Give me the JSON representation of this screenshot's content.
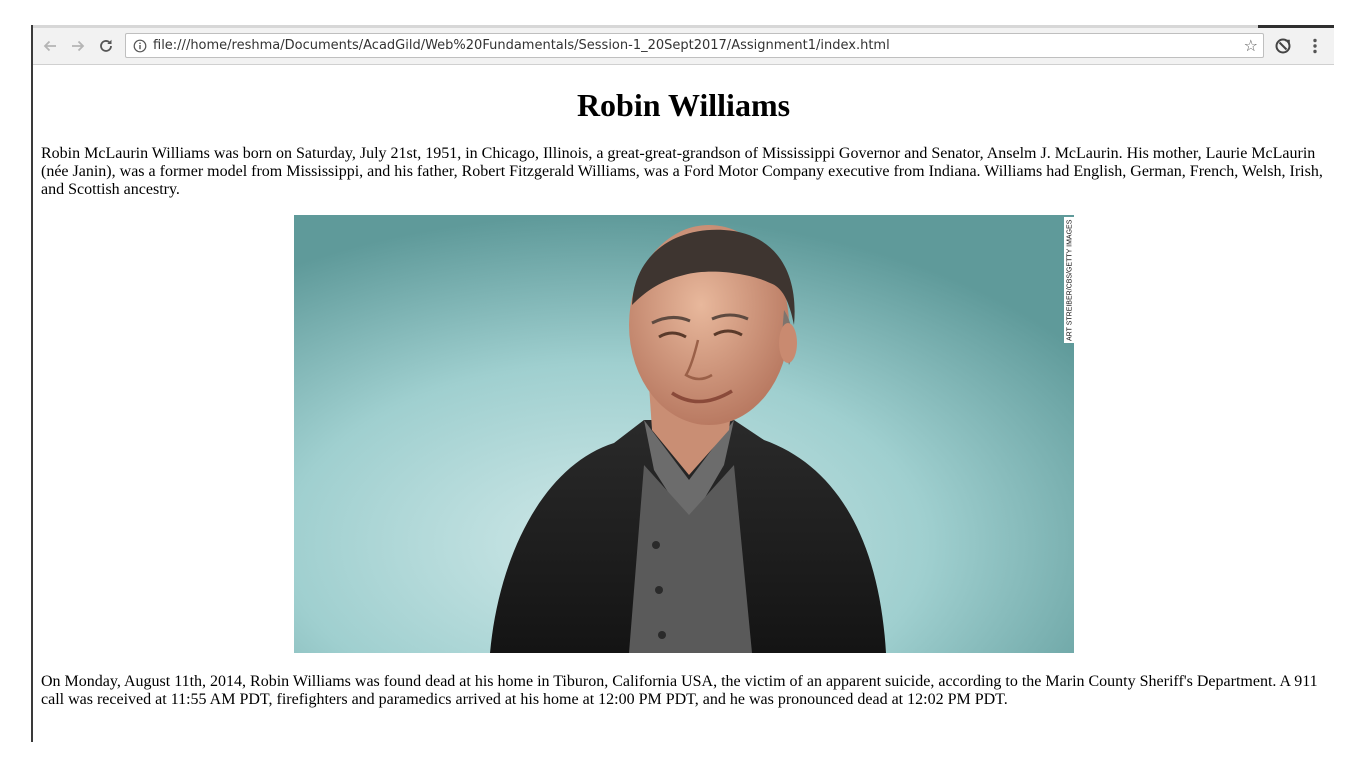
{
  "browser": {
    "url": "file:///home/reshma/Documents/AcadGild/Web%20Fundamentals/Session-1_20Sept2017/Assignment1/index.html",
    "icons": {
      "back": "arrow-left-icon",
      "forward": "arrow-right-icon",
      "reload": "reload-icon",
      "info": "info-icon",
      "bookmark": "star-icon",
      "extension": "extension-icon",
      "menu": "kebab-menu-icon"
    }
  },
  "page": {
    "title": "Robin Williams",
    "paragraph1": "Robin McLaurin Williams was born on Saturday, July 21st, 1951, in Chicago, Illinois, a great-great-grandson of Mississippi Governor and Senator, Anselm J. McLaurin. His mother, Laurie McLaurin (née Janin), was a former model from Mississippi, and his father, Robert Fitzgerald Williams, was a Ford Motor Company executive from Indiana. Williams had English, German, French, Welsh, Irish, and Scottish ancestry.",
    "photo_credit": "ART STREIBER/CBS/GETTY IMAGES",
    "paragraph2": "On Monday, August 11th, 2014, Robin Williams was found dead at his home in Tiburon, California USA, the victim of an apparent suicide, according to the Marin County Sheriff's Department. A 911 call was received at 11:55 AM PDT, firefighters and paramedics arrived at his home at 12:00 PM PDT, and he was pronounced dead at 12:02 PM PDT."
  }
}
